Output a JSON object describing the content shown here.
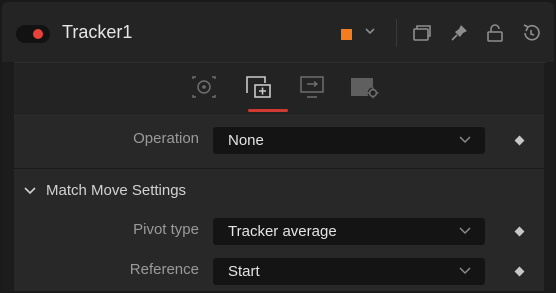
{
  "header": {
    "title": "Tracker1",
    "color_chip": "#F57D1F",
    "icons": [
      "toggle-switch",
      "color-chip",
      "chevron-down-icon",
      "version-icon",
      "pin-icon",
      "lock-icon",
      "reset-icon"
    ]
  },
  "tabs": [
    {
      "name": "tracker-tab",
      "icon": "target-icon"
    },
    {
      "name": "operation-tab",
      "icon": "operation-icon",
      "active": true
    },
    {
      "name": "display-tab",
      "icon": "display-icon"
    },
    {
      "name": "settings-tab",
      "icon": "settings-icon"
    }
  ],
  "controls": {
    "operation": {
      "label": "Operation",
      "value": "None"
    },
    "section_title": "Match Move Settings",
    "pivot_type": {
      "label": "Pivot type",
      "value": "Tracker average"
    },
    "reference": {
      "label": "Reference",
      "value": "Start"
    }
  },
  "colors": {
    "accent": "#D13A33",
    "toggle_dot": "#E8413B"
  }
}
